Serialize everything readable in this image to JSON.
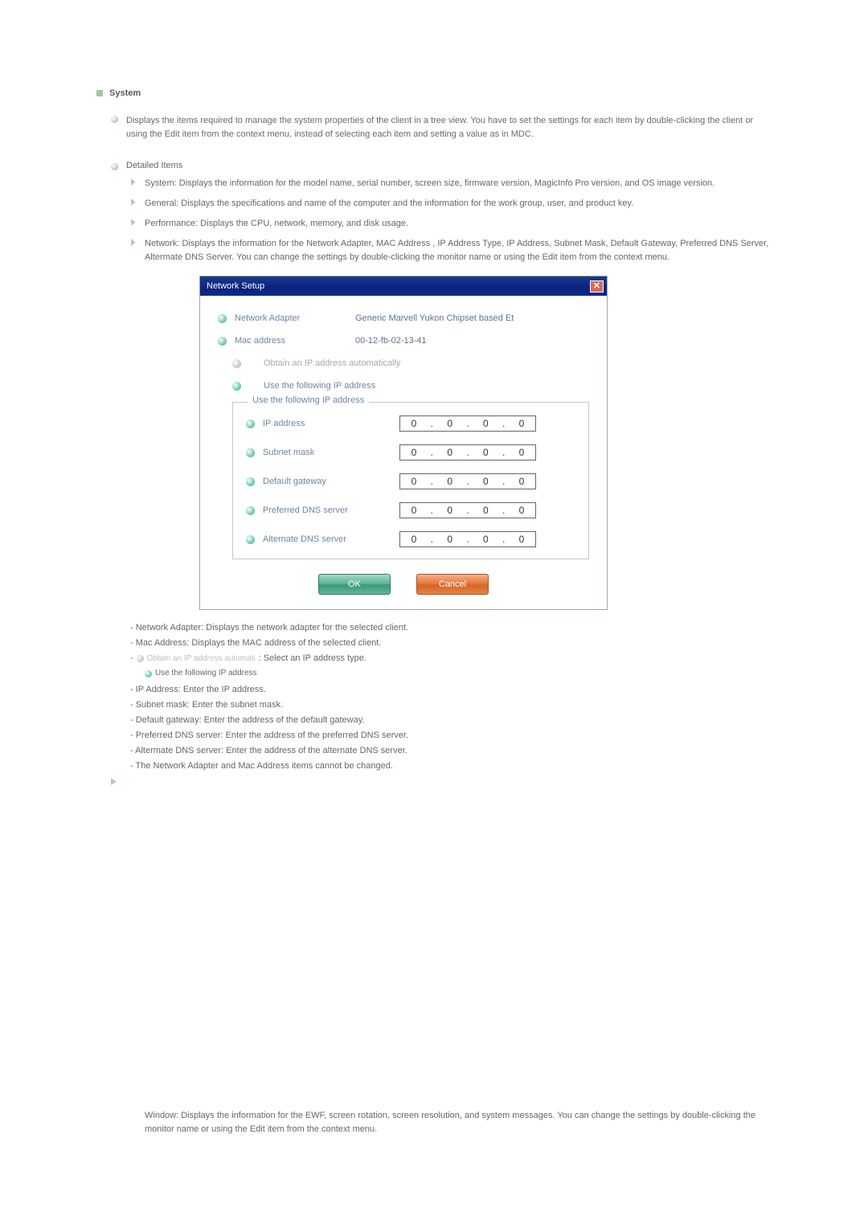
{
  "section": {
    "title": "System"
  },
  "intro": "Displays the items required to manage the system properties of the client in a tree view. You have to set the settings for each item by double-clicking the client or using the Edit item from the context menu, instead of selecting each item and setting a value as in MDC.",
  "detailed": {
    "title": "Detailed Items",
    "items": [
      "System: Displays the information for the model name, serial number, screen size, firmware version, MagicInfo Pro version, and OS image version.",
      "General: Displays the specifications and name of the computer and the information for the work group, user, and product key.",
      "Performance: Displays the CPU, network, memory, and disk usage.",
      "Network: Displays the information for the Network Adapter, MAC Address , IP Address Type, IP Address, Subnet Mask, Default Gateway, Preferred DNS Server, Altermate DNS Server. You can change the settings by double-clicking the monitor name or using the Edit item from the context menu."
    ]
  },
  "dialog": {
    "title": "Network Setup",
    "rows": {
      "adapter_label": "Network Adapter",
      "adapter_value": "Generic Marvell Yukon Chipset based Et",
      "mac_label": "Mac address",
      "mac_value": "00-12-fb-02-13-41",
      "auto_label": "Obtain an IP address automatically",
      "manual_label": "Use the following IP address"
    },
    "fieldset_title": "Use the following IP address",
    "fields": [
      {
        "label": "IP address",
        "octets": [
          "0",
          "0",
          "0",
          "0"
        ]
      },
      {
        "label": "Subnet mask",
        "octets": [
          "0",
          "0",
          "0",
          "0"
        ]
      },
      {
        "label": "Default gateway",
        "octets": [
          "0",
          "0",
          "0",
          "0"
        ]
      },
      {
        "label": "Preferred DNS server",
        "octets": [
          "0",
          "0",
          "0",
          "0"
        ]
      },
      {
        "label": "Alternate DNS server",
        "octets": [
          "0",
          "0",
          "0",
          "0"
        ]
      }
    ],
    "ok": "OK",
    "cancel": "Cancel"
  },
  "notes": {
    "n1": "- Network Adapter: Displays the network adapter for the selected client.",
    "n2": "- Mac Address: Displays the MAC address of the selected client.",
    "n3a": "- ",
    "n3_opt_auto": "Obtain an IP address automati",
    "n3b": " : Select an IP address type.",
    "n3_opt_manual": "Use the following IP address",
    "n4": "- IP Address: Enter the IP address.",
    "n5": "- Subnet mask: Enter the subnet mask.",
    "n6": "- Default gateway: Enter the address of the default gateway.",
    "n7": "- Preferred DNS server: Enter the address of the preferred DNS server.",
    "n8": "- Altermate DNS server: Enter the address of the alternate DNS server.",
    "n9": "- The Network Adapter and Mac Address items cannot be changed."
  },
  "bottom": "Window: Displays the information for the EWF, screen rotation, screen resolution, and system messages. You can change the settings by double-clicking the monitor name or using the Edit item from the context menu."
}
